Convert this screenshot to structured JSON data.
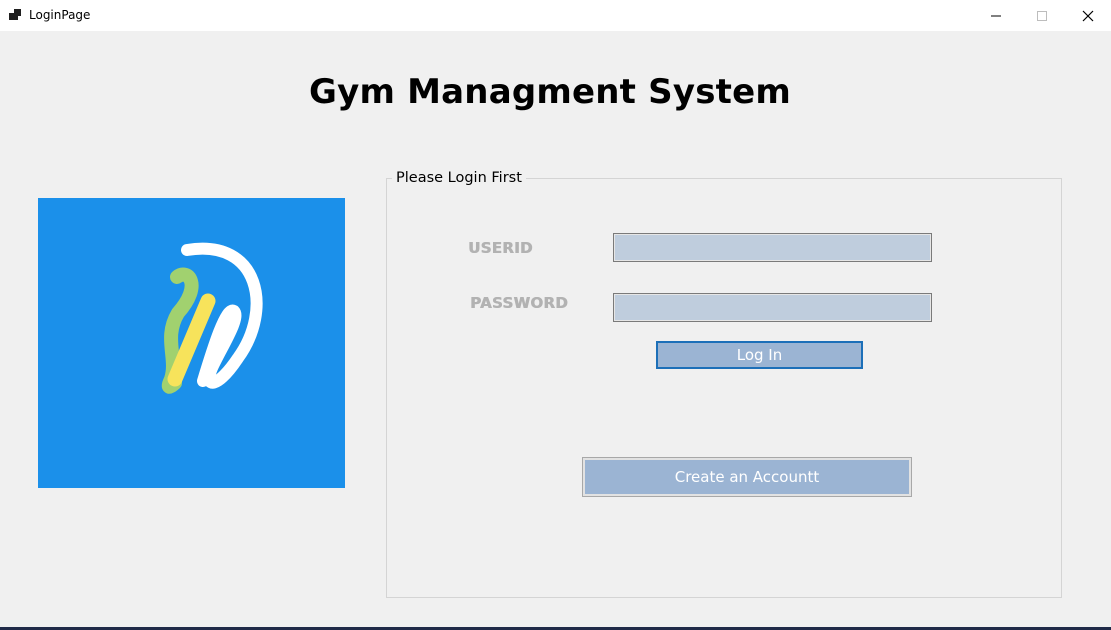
{
  "window": {
    "title": "LoginPage",
    "icons": {
      "app": "app-icon",
      "minimize": "minimize-icon",
      "maximize": "maximize-icon",
      "close": "close-icon"
    }
  },
  "main": {
    "heading": "Gym Managment System",
    "logo": {
      "name": "brand-logo",
      "background": "#1b90ea"
    }
  },
  "login_group": {
    "legend": "Please Login First",
    "userid_label": "USERID",
    "userid_value": "",
    "password_label": "PASSWORD",
    "password_value": "",
    "login_button": "Log In",
    "create_account_button": "Create an Accountt"
  },
  "colors": {
    "window_bg": "#f0f0f0",
    "input_bg": "#bfcddd",
    "button_bg": "#9bb4d3",
    "focus_border": "#1c6fb8",
    "label_color": "#b2b2b2"
  }
}
